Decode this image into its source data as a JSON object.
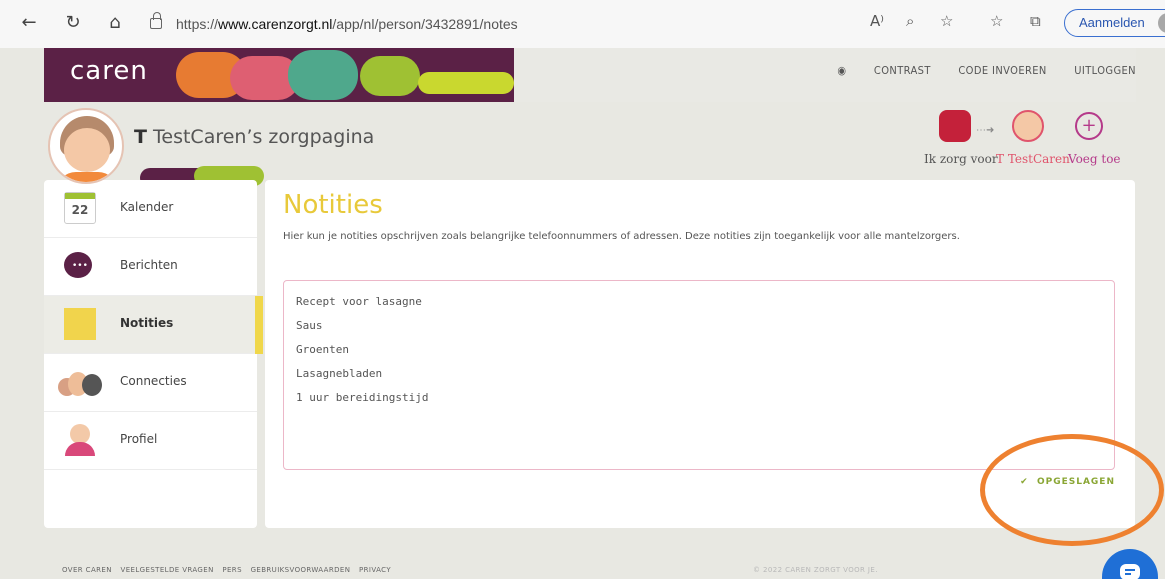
{
  "browser": {
    "url_prefix": "https://",
    "url_host": "www.carenzorgt.nl",
    "url_path": "/app/nl/person/3432891/notes",
    "signin_label": "Aanmelden",
    "read_aloud_glyph": "A⁾"
  },
  "banner": {
    "logo": "caren",
    "links": [
      "CONTRAST",
      "CODE INVOEREN",
      "UITLOGGEN"
    ]
  },
  "header": {
    "title_initial": "T",
    "title_rest": " TestCaren’s zorgpagina",
    "users": [
      {
        "label": "Ik zorg voor",
        "color": "#555555"
      },
      {
        "label": "T TestCaren",
        "color": "#e0546c"
      },
      {
        "label": "Voeg toe",
        "color": "#b53a8a"
      }
    ]
  },
  "sidebar": {
    "items": [
      {
        "label": "Kalender",
        "icon": "calendar-icon",
        "badge": "22"
      },
      {
        "label": "Berichten",
        "icon": "chat-bubble-icon"
      },
      {
        "label": "Notities",
        "icon": "note-icon",
        "active": true
      },
      {
        "label": "Connecties",
        "icon": "people-icon"
      },
      {
        "label": "Profiel",
        "icon": "profile-icon"
      }
    ]
  },
  "main": {
    "title": "Notities",
    "intro": "Hier kun je notities opschrijven zoals belangrijke telefoonnummers of adressen. Deze notities zijn toegankelijk voor alle mantelzorgers.",
    "note_lines": [
      "Recept voor lasagne",
      "Saus",
      "Groenten",
      "Lasagnebladen",
      "1 uur bereidingstijd"
    ],
    "saved_label": "OPGESLAGEN"
  },
  "footer": {
    "links": [
      "OVER CAREN",
      "VEELGESTELDE VRAGEN",
      "PERS",
      "GEBRUIKSVOORWAARDEN",
      "PRIVACY"
    ],
    "copyright": "© 2022 CAREN ZORGT VOOR JE."
  },
  "colors": {
    "accent_yellow": "#e8c93a",
    "accent_pink": "#e0546c",
    "saved_green": "#8aa634",
    "annotation_orange": "#ee8130"
  }
}
